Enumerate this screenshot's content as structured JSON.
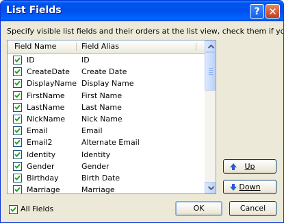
{
  "window": {
    "title": "List Fields",
    "help_glyph": "?",
    "close_glyph": "✕"
  },
  "instruction": "Specify visible list fields and their orders at the list view, check them if you want:",
  "list": {
    "columns": [
      "Field Name",
      "Field Alias"
    ],
    "rows": [
      {
        "name": "ID",
        "alias": "ID",
        "checked": true
      },
      {
        "name": "CreateDate",
        "alias": "Create Date",
        "checked": true
      },
      {
        "name": "DisplayName",
        "alias": "Display Name",
        "checked": true
      },
      {
        "name": "FirstName",
        "alias": "First Name",
        "checked": true
      },
      {
        "name": "LastName",
        "alias": "Last Name",
        "checked": true
      },
      {
        "name": "NickName",
        "alias": "Nick Name",
        "checked": true
      },
      {
        "name": "Email",
        "alias": "Email",
        "checked": true
      },
      {
        "name": "Email2",
        "alias": "Alternate Email",
        "checked": true
      },
      {
        "name": "Identity",
        "alias": "Identity",
        "checked": true
      },
      {
        "name": "Gender",
        "alias": "Gender",
        "checked": true
      },
      {
        "name": "Birthday",
        "alias": "Birth Date",
        "checked": true
      },
      {
        "name": "Marriage",
        "alias": "Marriage",
        "checked": true
      }
    ]
  },
  "buttons": {
    "up": "Up",
    "down": "Down",
    "ok": "OK",
    "cancel": "Cancel"
  },
  "all_fields": {
    "label": "All Fields",
    "checked": true
  },
  "colors": {
    "title_bar": "#0054e3",
    "check": "#21a121",
    "arrow": "#2a5bd7"
  }
}
